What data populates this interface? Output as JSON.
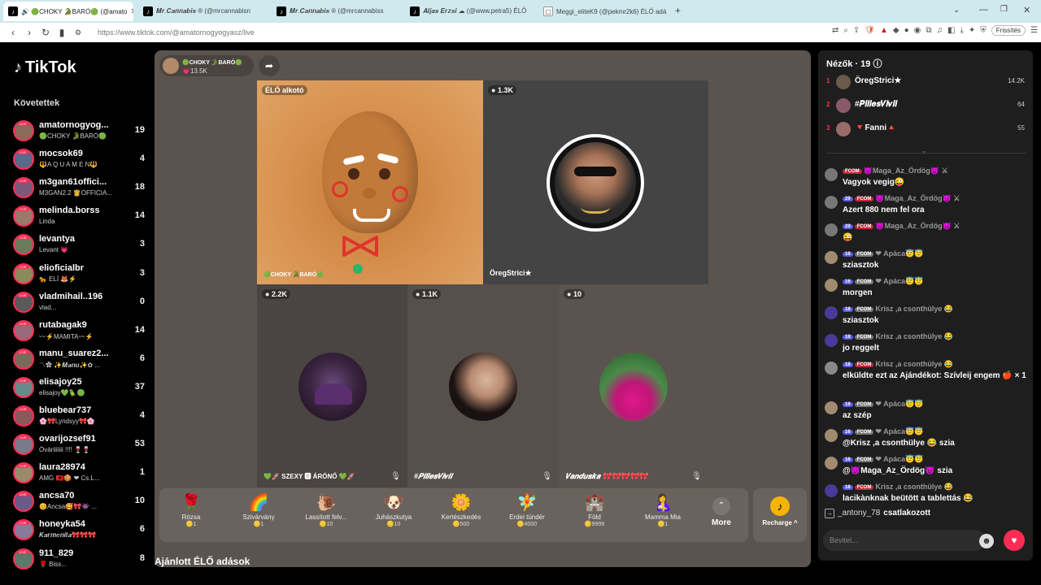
{
  "browser": {
    "tabs": [
      {
        "title": "🔊 🟢CHOKY 🐊BARÓ🟢 (@amato",
        "active": true
      },
      {
        "title": "𝑴𝒓.𝑪𝒂𝒏𝒏𝒂𝒃𝒊𝒔 ® (@mrcannabisn"
      },
      {
        "title": "𝑴𝒓.𝑪𝒂𝒏𝒏𝒂𝒃𝒊𝒔 ® (@mrcannabiss"
      },
      {
        "title": "𝑨𝒍𝒋𝒂𝒔 𝑬𝒓𝒛𝒔𝒊 ☁ (@www.petra5) ÉLŐ"
      },
      {
        "title": "Meggi_eliteK9 (@pekmr2k6) ÉLŐ adá"
      }
    ],
    "url": "https://www.tiktok.com/@amatornogyogyasz/live",
    "refresh_label": "Frissítés"
  },
  "sidebar": {
    "logo": "TikTok",
    "following_heading": "Követettek",
    "live_badge": "LIVE",
    "items": [
      {
        "name": "amatornogyog...",
        "sub": "🟢CHOKY 🐊BARÓ🟢",
        "count": "19"
      },
      {
        "name": "mocsok69",
        "sub": "🔱A Q U A M E N🔱",
        "count": "4"
      },
      {
        "name": "m3gan61offici...",
        "sub": "M3GAN2.2 👸OFFICIA...",
        "count": "18"
      },
      {
        "name": "melinda.borss",
        "sub": "Linda",
        "count": "14"
      },
      {
        "name": "levantya",
        "sub": "Levant 💗",
        "count": "3"
      },
      {
        "name": "elioficialbr",
        "sub": "🐆 ELÍ 🦊⚡",
        "count": "3"
      },
      {
        "name": "vladmihail..196",
        "sub": "vlad...",
        "count": "0"
      },
      {
        "name": "rutabagak9",
        "sub": "〰⚡MAMITA〰⚡",
        "count": "14"
      },
      {
        "name": "manu_suarez2...",
        "sub": "〽✿ ✨𝑴𝒂𝒏𝒖✨✿ ...",
        "count": "6"
      },
      {
        "name": "elisajoy25",
        "sub": "elisajoy💚🦜🟢",
        "count": "37"
      },
      {
        "name": "bluebear737",
        "sub": "🌸🎀Lyndsyy🎀🌸",
        "count": "4"
      },
      {
        "name": "ovarijozsef91",
        "sub": "Óváriiiiiii !!!! 🍷🍷",
        "count": "53"
      },
      {
        "name": "laura28974",
        "sub": "AMG 🇦🇱🍪 ❤ Cs.L...",
        "count": "1"
      },
      {
        "name": "ancsa70",
        "sub": "😊Ancsa🥰🎀👾 ...",
        "count": "10"
      },
      {
        "name": "honeyka54",
        "sub": "𝑲𝒂𝒓𝒎𝒆𝒏𝒊𝒕𝒂🎀🎀🎀",
        "count": "6"
      },
      {
        "name": "911_829",
        "sub": "🌹 Biss...",
        "count": "8"
      }
    ]
  },
  "stage": {
    "host_name": "🟢CHOKY 🐊BARÓ🟢",
    "host_likes": "💗13.5K",
    "host_panel_badge": "ÉLŐ alkotó",
    "host_panel_label": "🟢CHOKY 🐊BARÓ🟢",
    "guests": [
      {
        "viewers": "1.3K",
        "label": "ÖregStrici★"
      },
      {
        "viewers": "2.2K",
        "label": "💚🚀 SZEXY 🅱 ÁRÓNŐ 💚🚀"
      },
      {
        "viewers": "1.1K",
        "label": "#𝑷𝒊𝒍𝒍𝒆𝒔𝑽𝒊𝒗𝒊𝒊"
      },
      {
        "viewers": "10",
        "label": "𝑽𝒂𝒏𝒅𝒖𝒔𝒌𝒂 🎀🎀🎀🎀🎀"
      }
    ]
  },
  "gifts": [
    {
      "icon": "🌹",
      "name": "Rózsa",
      "price": "🪙1"
    },
    {
      "icon": "🌈",
      "name": "Szivárvány",
      "price": "🪙1"
    },
    {
      "icon": "🐌",
      "name": "Lassított felv...",
      "price": "🪙10"
    },
    {
      "icon": "🐶",
      "name": "Juhászkutya",
      "price": "🪙10"
    },
    {
      "icon": "🌼",
      "name": "Kertészkedés",
      "price": "🪙500"
    },
    {
      "icon": "🧚",
      "name": "Erdei tündér",
      "price": "🪙4000"
    },
    {
      "icon": "🏰",
      "name": "Föld",
      "price": "🪙9999"
    },
    {
      "icon": "🤱",
      "name": "Mamma Mia",
      "price": "🪙1"
    }
  ],
  "gift_more_label": "More",
  "recharge_label": "Recharge ^",
  "recommended_heading": "Ajánlott ÉLŐ adások",
  "right_panel": {
    "viewers_heading": "Nézők · 19 ⓘ",
    "top_viewers": [
      {
        "rank": "1",
        "name": "ÖregStrici★",
        "count": "14.2K"
      },
      {
        "rank": "2",
        "name": "#𝑷𝒊𝒍𝒍𝒆𝒔𝑽𝒊𝒗𝒊𝒊",
        "count": "64"
      },
      {
        "rank": "3",
        "name": "🔻Fanni🔺",
        "count": "55"
      }
    ],
    "chat": [
      {
        "lvl": "",
        "fc": "FCOM",
        "fcg": false,
        "user": "😈Maga_Az_Ördög😈 ⚔",
        "text": "Vagyok vegig😜"
      },
      {
        "lvl": "29",
        "fc": "FCOM",
        "fcg": false,
        "user": "😈Maga_Az_Ördög😈 ⚔",
        "text": "Azert 880 nem fel ora"
      },
      {
        "lvl": "29",
        "fc": "FCOM",
        "fcg": false,
        "user": "😈Maga_Az_Ördög😈 ⚔",
        "text": "😜"
      },
      {
        "lvl": "16",
        "fc": "FCOM",
        "fcg": true,
        "user": "❤ Apáca😇😇",
        "text": "sziasztok"
      },
      {
        "lvl": "16",
        "fc": "FCOM",
        "fcg": true,
        "user": "❤ Apáca😇😇",
        "text": "morgen"
      },
      {
        "lvl": "18",
        "fc": "FCOM",
        "fcg": true,
        "user": "Krisz ,a csonthülye 😂",
        "text": "sziasztok"
      },
      {
        "lvl": "18",
        "fc": "FCOM",
        "fcg": true,
        "user": "Krisz ,a csonthülye 😂",
        "text": "jo reggelt"
      },
      {
        "lvl": "18",
        "fc": "FCOM",
        "fcg": false,
        "user": "Krisz ,a csonthülye 😂",
        "text": "elküldte ezt az Ajándékot: Szívleij engem 🍎 × 1"
      },
      {
        "lvl": "16",
        "fc": "FCOM",
        "fcg": true,
        "user": "❤ Apáca😇😇",
        "text": "az szép"
      },
      {
        "lvl": "16",
        "fc": "FCOM",
        "fcg": true,
        "user": "❤ Apáca😇😇",
        "text": "@Krisz ,a csonthülye 😂 szia"
      },
      {
        "lvl": "16",
        "fc": "FCOM",
        "fcg": true,
        "user": "❤ Apáca😇😇",
        "text": "@😈Maga_Az_Ördög😈 szia"
      },
      {
        "lvl": "18",
        "fc": "FCOM",
        "fcg": false,
        "user": "Krisz ,a csonthülye 😂",
        "text": "lacikànknak beütött a tablettás 😂"
      }
    ],
    "joined_user": "_antony_78",
    "joined_text": "csatlakozott",
    "input_placeholder": "Bevitel..."
  }
}
